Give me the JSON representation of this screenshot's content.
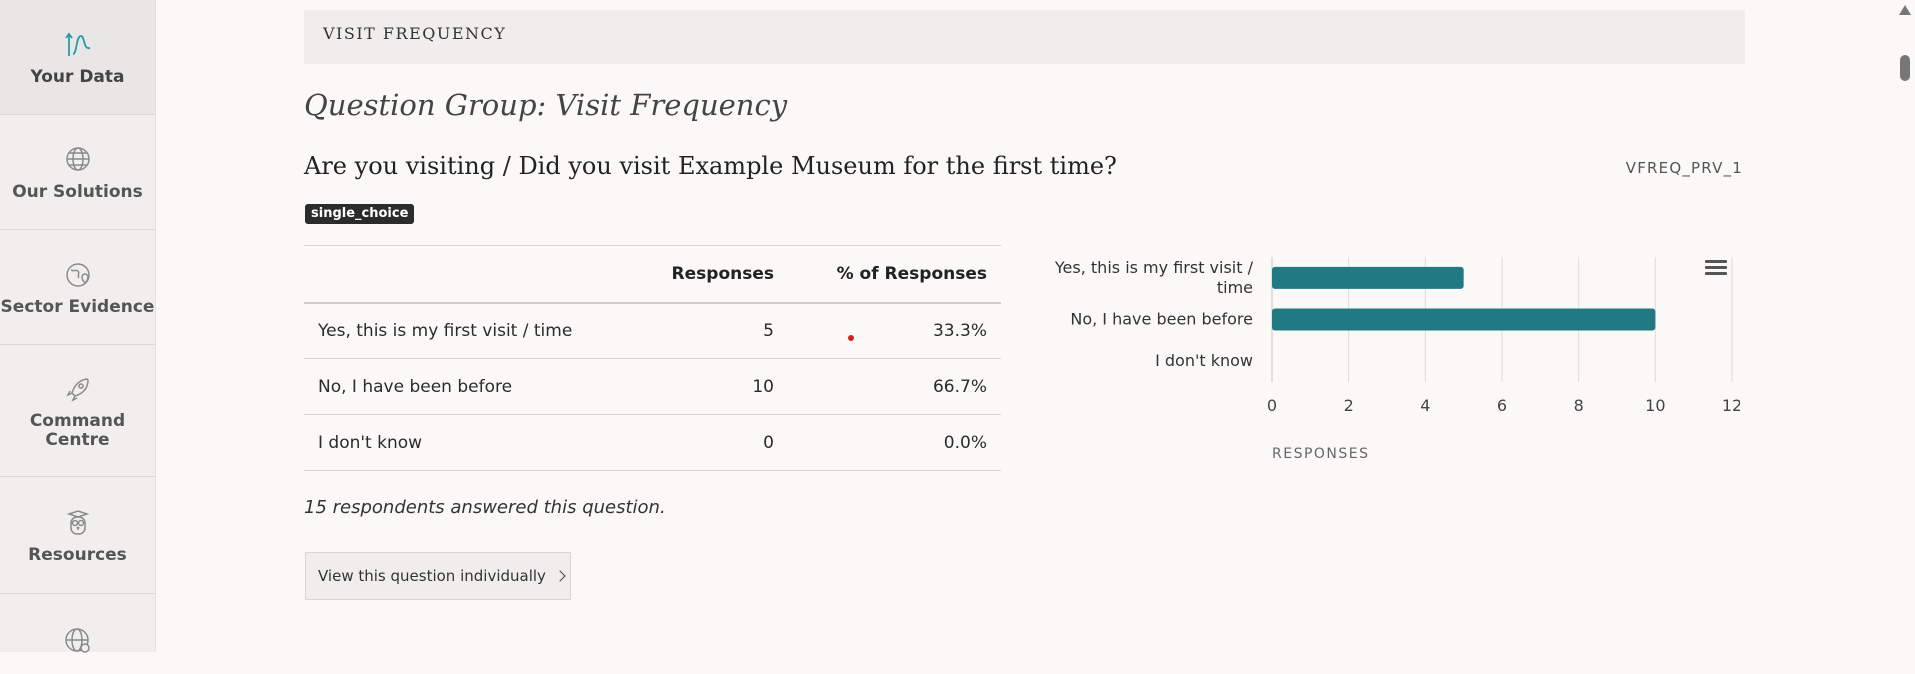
{
  "sidebar": {
    "items": [
      {
        "label": "Your Data",
        "icon": "chart-line-icon"
      },
      {
        "label": "Our Solutions",
        "icon": "globe-icon"
      },
      {
        "label": "Sector Evidence",
        "icon": "globe-pin-icon"
      },
      {
        "label": "Command Centre",
        "icon": "rocket-icon"
      },
      {
        "label": "Resources",
        "icon": "owl-icon"
      },
      {
        "label": "",
        "icon": "globe-gear-icon"
      }
    ]
  },
  "section": {
    "header": "VISIT FREQUENCY"
  },
  "group": {
    "title": "Question Group: Visit Frequency"
  },
  "question": {
    "title": "Are you visiting / Did you visit Example Museum for the first time?",
    "code": "VFREQ_PRV_1",
    "type_badge": "single_choice"
  },
  "table": {
    "headers": [
      "",
      "Responses",
      "% of Responses"
    ],
    "rows": [
      {
        "label": "Yes, this is my first visit / time",
        "responses": "5",
        "percent": "33.3%"
      },
      {
        "label": "No, I have been before",
        "responses": "10",
        "percent": "66.7%"
      },
      {
        "label": "I don't know",
        "responses": "0",
        "percent": "0.0%"
      }
    ]
  },
  "summary": {
    "respondents": "15 respondents answered this question."
  },
  "button": {
    "view_label": "View this question individually"
  },
  "chart_data": {
    "type": "bar",
    "orientation": "horizontal",
    "categories": [
      "Yes, this is my first visit / time",
      "No, I have been before",
      "I don't know"
    ],
    "category_lines": [
      [
        "Yes, this is my first visit /",
        "time"
      ],
      [
        "No, I have been before"
      ],
      [
        "I don't know"
      ]
    ],
    "values": [
      5,
      10,
      0
    ],
    "xlabel": "RESPONSES",
    "xlim": [
      0,
      12
    ],
    "xticks": [
      "0",
      "2",
      "4",
      "6",
      "8",
      "10",
      "12"
    ],
    "grid": true,
    "bar_color": "#217a82"
  }
}
